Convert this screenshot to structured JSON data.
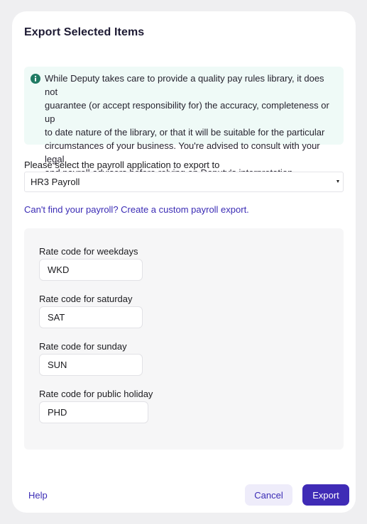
{
  "dialog": {
    "title": "Export Selected Items"
  },
  "info": {
    "icon": "info-icon",
    "color": "#1f7a63",
    "text": "While Deputy takes care to provide a quality pay rules library, it does not\nguarantee (or accept responsibility for) the accuracy, completeness or up\nto date nature of the library, or that it will be suitable for the particular\ncircumstances of your business. You're advised to consult with your legal\nand payroll advisers before relying on Deputy's interpretation."
  },
  "payroll_select": {
    "label": "Please select the payroll application to export to",
    "value": "HR3 Payroll"
  },
  "custom_link": "Can't find your payroll? Create a custom payroll export.",
  "rates": [
    {
      "label": "Rate code for weekdays",
      "value": "WKD"
    },
    {
      "label": "Rate code for saturday",
      "value": "SAT"
    },
    {
      "label": "Rate code for sunday",
      "value": "SUN"
    },
    {
      "label": "Rate code for public holiday",
      "value": "PHD"
    }
  ],
  "footer": {
    "help": "Help",
    "cancel": "Cancel",
    "export": "Export"
  },
  "colors": {
    "accent": "#3f2bb6",
    "info_bg": "#effaf7"
  }
}
